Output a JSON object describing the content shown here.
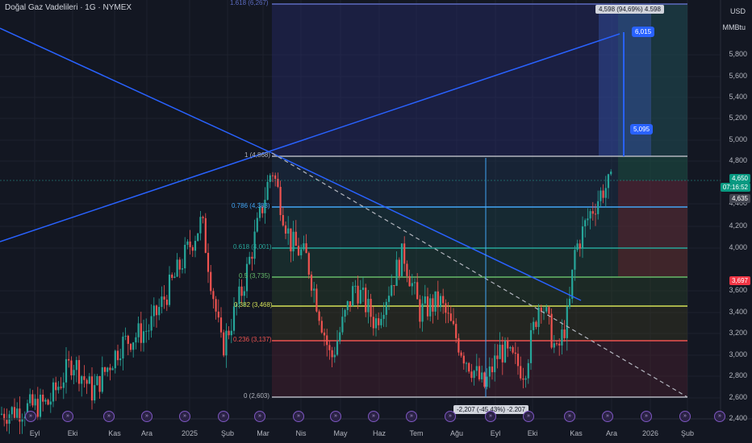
{
  "title": "Doğal Gaz Vadelileri · 1G · NYMEX",
  "axis": {
    "currency": "USD",
    "unit": "MMBtu",
    "price_ticks": [
      "5,800",
      "5,600",
      "5,400",
      "5,200",
      "5,000",
      "4,800",
      "4,400",
      "4,200",
      "4,000",
      "3,600",
      "3,400",
      "3,200",
      "3,000",
      "2,800",
      "2,600",
      "2,400"
    ],
    "time_ticks": [
      "Eyl",
      "Eki",
      "Kas",
      "Ara",
      "2025",
      "Şub",
      "Mar",
      "Nis",
      "May",
      "Haz",
      "Tem",
      "Ağu",
      "Eyl",
      "Eki",
      "Kas",
      "Ara",
      "2026",
      "Şub"
    ]
  },
  "badges": {
    "last_price": "4,650",
    "countdown": "07:16:52",
    "prev_close": "4,635",
    "stop_level": "3,697"
  },
  "fib_levels": [
    {
      "ratio": "1.618",
      "label": "1.618 (6,267)",
      "color": "#5c6bc0"
    },
    {
      "ratio": "1",
      "label": "1 (4,868)",
      "color": "#b2b5be"
    },
    {
      "ratio": "0.786",
      "label": "0.786 (4,383)",
      "color": "#42a5f5"
    },
    {
      "ratio": "0.618",
      "label": "0.618 (4,001)",
      "color": "#26a69a"
    },
    {
      "ratio": "0.5",
      "label": "0.5 (3,735)",
      "color": "#66bb6a"
    },
    {
      "ratio": "0.382",
      "label": "0.382 (3,468)",
      "color": "#d4e157"
    },
    {
      "ratio": "0.236",
      "label": "0.236 (3,137)",
      "color": "#ef5350"
    },
    {
      "ratio": "0",
      "label": "0 (2,603)",
      "color": "#b2b5be"
    }
  ],
  "measure": {
    "top_label": "4,598 (94,69%) 4.598",
    "bottom_label": "-2,207 (-45,43%) -2.207",
    "target_high": "6,015",
    "target_low": "5,095"
  },
  "colors": {
    "background": "#131722",
    "up": "#26a69a",
    "down": "#ef5350",
    "trend": "#2962ff",
    "accent": "#2962ff"
  },
  "event_icon": "»"
}
